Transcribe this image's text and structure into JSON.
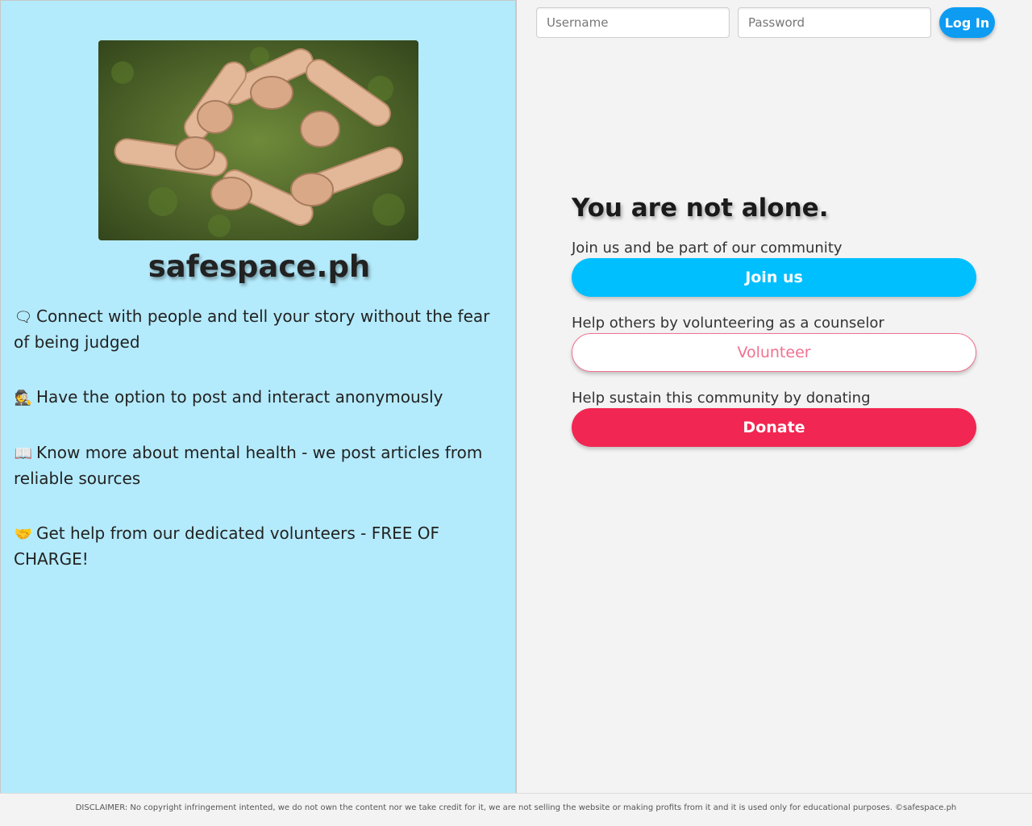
{
  "brand": {
    "name": "safespace.ph"
  },
  "hero_image": {
    "alt": "hands holding wrists in a circle over grass"
  },
  "features": [
    {
      "icon": "chat-bubbles-icon",
      "glyph": "🗨",
      "text": "Connect with people and tell your story without the fear of being judged"
    },
    {
      "icon": "user-secret-icon",
      "glyph": "🕵",
      "text": "Have the option to post and interact anonymously"
    },
    {
      "icon": "book-open-icon",
      "glyph": "📖",
      "text": "Know more about mental health - we post articles from reliable sources"
    },
    {
      "icon": "hands-helping-icon",
      "glyph": "🤝",
      "text": "Get help from our dedicated volunteers - FREE OF CHARGE!"
    }
  ],
  "login": {
    "username_placeholder": "Username",
    "password_placeholder": "Password",
    "button_label": "Log In"
  },
  "cta": {
    "title": "You are not alone.",
    "join_desc": "Join us and be part of our community",
    "join_label": "Join us",
    "volunteer_desc": "Help others by volunteering as a counselor",
    "volunteer_label": "Volunteer",
    "donate_desc": "Help sustain this community by donating",
    "donate_label": "Donate"
  },
  "footer": {
    "disclaimer": "DISCLAIMER: No copyright infringement intented, we do not own the content nor we take credit for it, we are not selling the website or making profits from it and it is used only for educational purposes. ©safespace.ph"
  },
  "colors": {
    "left_panel_bg": "#b4ebfc",
    "login_button": "#0d9cf2",
    "join_button": "#00bfff",
    "volunteer_accent": "#f0718f",
    "donate_button": "#f22652"
  }
}
